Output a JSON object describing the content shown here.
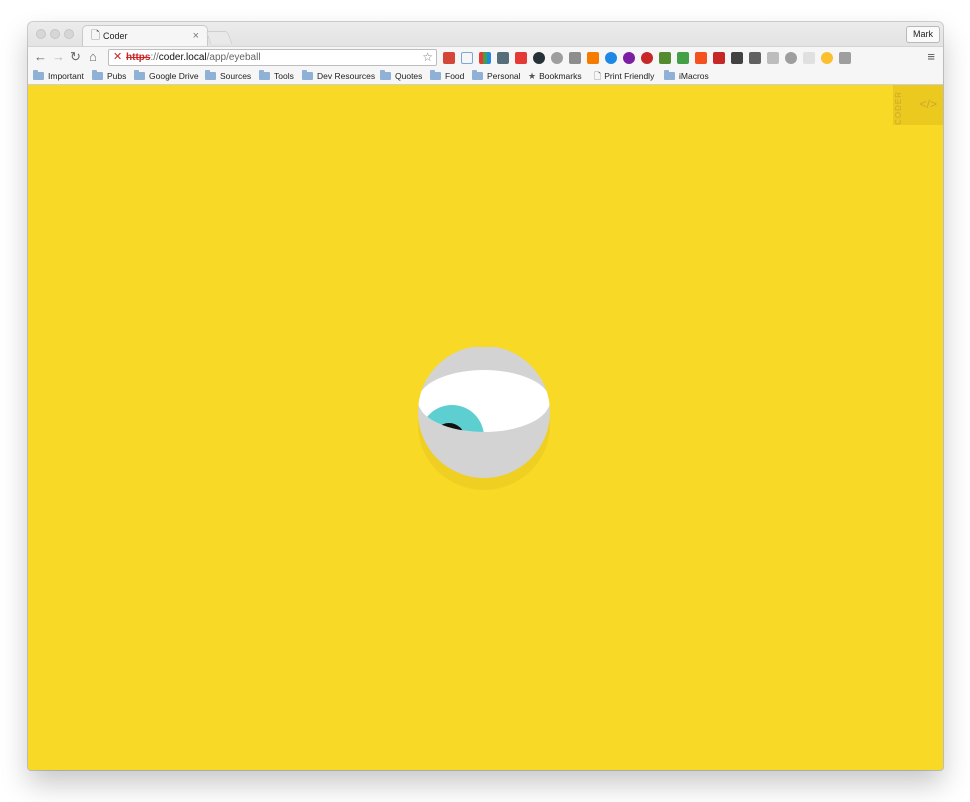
{
  "window": {
    "tab_title": "Coder",
    "tab_close": "×",
    "profile_name": "Mark"
  },
  "toolbar": {
    "url_scheme": "https",
    "url_sep": "://",
    "url_host": "coder.local",
    "url_path": "/app/eyeball",
    "menu_icon": "≡"
  },
  "bookmarks": [
    {
      "label": "Important",
      "icon": "folder-icon"
    },
    {
      "label": "Pubs",
      "icon": "folder-icon"
    },
    {
      "label": "Google Drive",
      "icon": "folder-icon"
    },
    {
      "label": "Sources",
      "icon": "folder-icon"
    },
    {
      "label": "Tools",
      "icon": "folder-icon"
    },
    {
      "label": "Dev Resources",
      "icon": "folder-icon"
    },
    {
      "label": "Quotes",
      "icon": "folder-icon"
    },
    {
      "label": "Food",
      "icon": "folder-icon"
    },
    {
      "label": "Personal",
      "icon": "folder-icon"
    },
    {
      "label": "Bookmarks",
      "icon": "star-icon"
    },
    {
      "label": "Print Friendly",
      "icon": "page-icon"
    },
    {
      "label": "iMacros",
      "icon": "folder-icon"
    }
  ],
  "coder": {
    "label": "CODER",
    "code_icon": "</>"
  },
  "colors": {
    "page_bg": "#f7d926",
    "iris": "#5ecfd1",
    "sclera": "#ffffff",
    "eyeball_shell": "#cfcfcf",
    "pupil": "#111111"
  }
}
